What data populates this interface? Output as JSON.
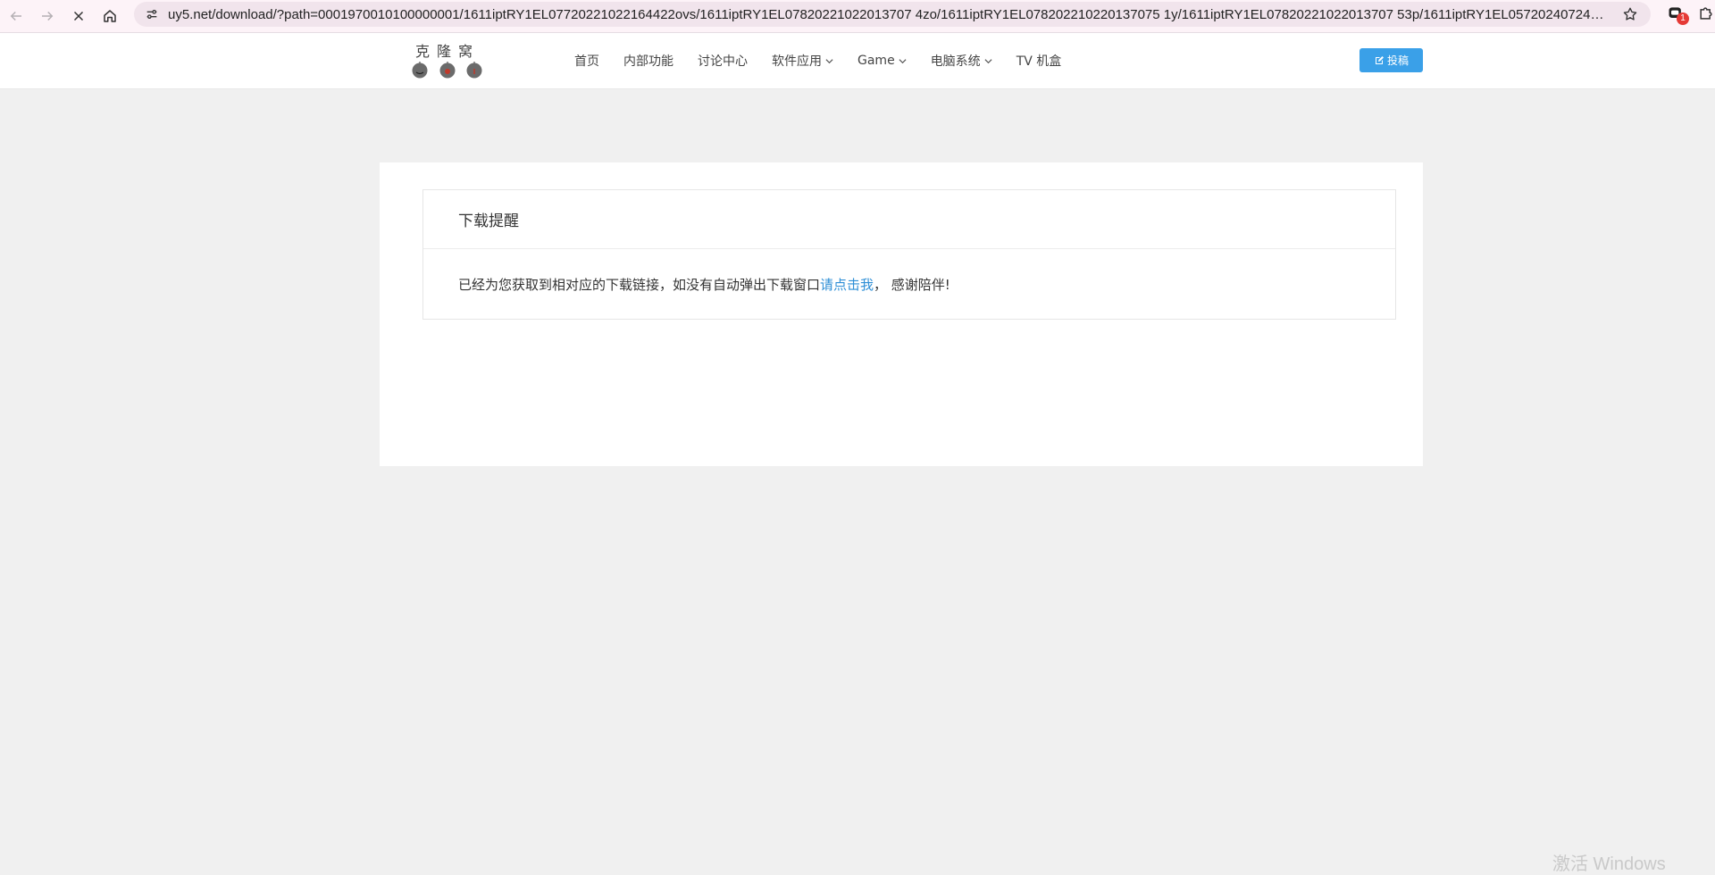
{
  "browser": {
    "url": "uy5.net/download/?path=0001970010100000001/1611iptRY1EL07720221022164422ovs/1611iptRY1EL07820221022013707 4zo/1611iptRY1EL078202210220137075 1y/1611iptRY1EL07820221022013707 53p/1611iptRY1EL05720240724191119...",
    "extension_badge": "1"
  },
  "header": {
    "logo_text": "克隆窝",
    "nav": [
      {
        "label": "首页",
        "dropdown": false
      },
      {
        "label": "内部功能",
        "dropdown": false
      },
      {
        "label": "讨论中心",
        "dropdown": false
      },
      {
        "label": "软件应用",
        "dropdown": true
      },
      {
        "label": "Game",
        "dropdown": true
      },
      {
        "label": "电脑系统",
        "dropdown": true
      },
      {
        "label": "TV 机盒",
        "dropdown": false
      }
    ],
    "post_button": "投稿",
    "accent_color": "#3aa0e8"
  },
  "notice": {
    "title": "下载提醒",
    "message_before": "已经为您获取到相对应的下载链接，如没有自动弹出下载窗口",
    "link_text": "请点击我",
    "message_after": "， 感谢陪伴!"
  },
  "watermark": "激活 Windows"
}
